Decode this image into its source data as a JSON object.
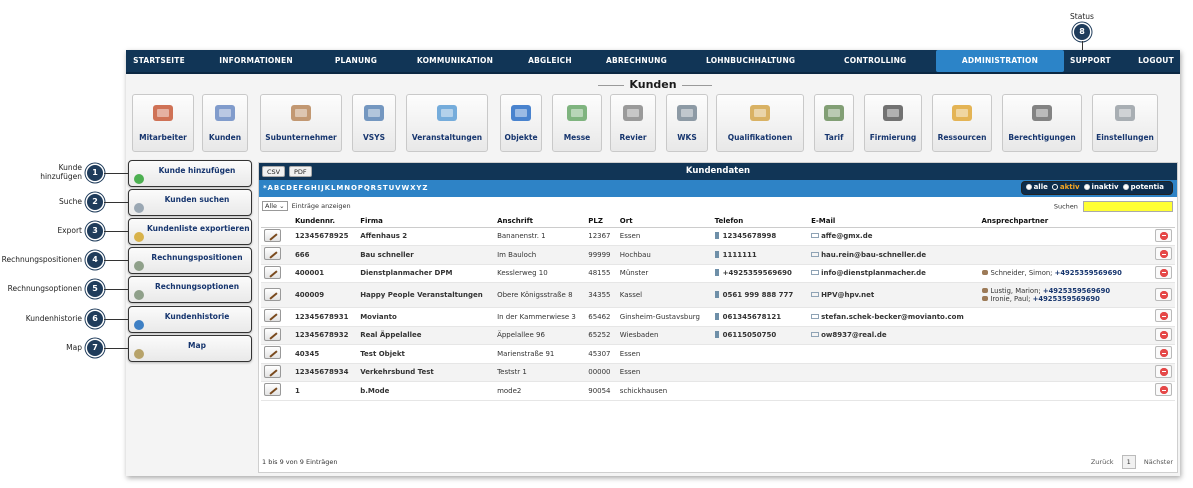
{
  "status_annotation": {
    "label": "Status",
    "number": "8"
  },
  "nav": [
    {
      "label": "STARTSEITE",
      "active": false
    },
    {
      "label": "INFORMATIONEN",
      "active": false
    },
    {
      "label": "PLANUNG",
      "active": false
    },
    {
      "label": "KOMMUNIKATION",
      "active": false
    },
    {
      "label": "ABGLEICH",
      "active": false
    },
    {
      "label": "ABRECHNUNG",
      "active": false
    },
    {
      "label": "LOHNBUCHHALTUNG",
      "active": false
    },
    {
      "label": "CONTROLLING",
      "active": false
    },
    {
      "label": "ADMINISTRATION",
      "active": true
    },
    {
      "label": "SUPPORT",
      "active": false
    },
    {
      "label": "LOGOUT",
      "active": false
    }
  ],
  "section_title": "Kunden",
  "modules": [
    {
      "label": "Mitarbeiter",
      "icon": "people-icon"
    },
    {
      "label": "Kunden",
      "icon": "handshake-icon"
    },
    {
      "label": "Subunternehmer",
      "icon": "partners-icon"
    },
    {
      "label": "VSYS",
      "icon": "network-icon"
    },
    {
      "label": "Veranstaltungen",
      "icon": "event-screen-icon"
    },
    {
      "label": "Objekte",
      "icon": "cube-icon"
    },
    {
      "label": "Messe",
      "icon": "floorplan-icon"
    },
    {
      "label": "Revier",
      "icon": "district-icon"
    },
    {
      "label": "WKS",
      "icon": "document-icon"
    },
    {
      "label": "Qualifikationen",
      "icon": "certificate-icon"
    },
    {
      "label": "Tarif",
      "icon": "tariff-icon"
    },
    {
      "label": "Firmierung",
      "icon": "phone-icon"
    },
    {
      "label": "Ressourcen",
      "icon": "boxes-icon"
    },
    {
      "label": "Berechtigungen",
      "icon": "user-key-icon"
    },
    {
      "label": "Einstellungen",
      "icon": "wrench-icon"
    }
  ],
  "sidebar": [
    {
      "label": "Kunde hinzufügen",
      "icon": "add-icon",
      "icon_color": "#4caf50",
      "annotation": "Kunde hinzufügen",
      "number": "1"
    },
    {
      "label": "Kunden suchen",
      "icon": "search-icon",
      "icon_color": "#9aa7b3",
      "annotation": "Suche",
      "number": "2"
    },
    {
      "label": "Kundenliste exportieren",
      "icon": "export-icon",
      "icon_color": "#d8b24a",
      "annotation": "Export",
      "number": "3"
    },
    {
      "label": "Rechnungspositionen",
      "icon": "invoice-icon",
      "icon_color": "#8fa08a",
      "annotation": "Rechnungspositionen",
      "number": "4"
    },
    {
      "label": "Rechnungsoptionen",
      "icon": "invoice-options-icon",
      "icon_color": "#8fa08a",
      "annotation": "Rechnungsoptionen",
      "number": "5"
    },
    {
      "label": "Kundenhistorie",
      "icon": "info-icon",
      "icon_color": "#3d7fc4",
      "annotation": "Kundenhistorie",
      "number": "6"
    },
    {
      "label": "Map",
      "icon": "map-icon",
      "icon_color": "#b7a36a",
      "annotation": "Map",
      "number": "7"
    }
  ],
  "panel": {
    "title": "Kundendaten",
    "csv": "CSV",
    "pdf": "PDF",
    "alphabet": "*ABCDEFGHIJKLMNOPQRSTUVWXYZ",
    "status_options": [
      {
        "label": "alle",
        "selected": false
      },
      {
        "label": "aktiv",
        "selected": true
      },
      {
        "label": "inaktiv",
        "selected": false
      },
      {
        "label": "potentia",
        "selected": false
      }
    ],
    "page_size": "Alle",
    "entries_label": "Einträge anzeigen",
    "search_label": "Suchen",
    "columns": [
      "",
      "Kundennr.",
      "Firma",
      "Anschrift",
      "PLZ",
      "Ort",
      "Telefon",
      "E-Mail",
      "Ansprechpartner",
      ""
    ],
    "rows": [
      {
        "knr": "12345678925",
        "firma": "Affenhaus 2",
        "anschrift": "Bananenstr. 1",
        "plz": "12367",
        "ort": "Essen",
        "telefon": "12345678998",
        "email": "affe@gmx.de",
        "contacts": []
      },
      {
        "knr": "666",
        "firma": "Bau schneller",
        "anschrift": "Im Bauloch",
        "plz": "99999",
        "ort": "Hochbau",
        "telefon": "1111111",
        "email": "hau.rein@bau-schneller.de",
        "contacts": []
      },
      {
        "knr": "400001",
        "firma": "Dienstplanmacher DPM",
        "anschrift": "Kesslerweg 10",
        "plz": "48155",
        "ort": "Münster",
        "telefon": "+4925359569690",
        "email": "info@dienstplanmacher.de",
        "contacts": [
          {
            "name": "Schneider, Simon;",
            "phone": "+4925359569690"
          }
        ]
      },
      {
        "knr": "400009",
        "firma": "Happy People Veranstaltungen",
        "anschrift": "Obere Königsstraße 8",
        "plz": "34355",
        "ort": "Kassel",
        "telefon": "0561 999 888 777",
        "email": "HPV@hpv.net",
        "contacts": [
          {
            "name": "Lustig, Marion;",
            "phone": "+4925359569690"
          },
          {
            "name": "Ironie, Paul;",
            "phone": "+4925359569690"
          }
        ]
      },
      {
        "knr": "12345678931",
        "firma": "Movianto",
        "anschrift": "In der Kammerwiese 3",
        "plz": "65462",
        "ort": "Ginsheim-Gustavsburg",
        "telefon": "061345678121",
        "email": "stefan.schek-becker@movianto.com",
        "contacts": []
      },
      {
        "knr": "12345678932",
        "firma": "Real Äppelallee",
        "anschrift": "Äppelallee 96",
        "plz": "65252",
        "ort": "Wiesbaden",
        "telefon": "06115050750",
        "email": "ow8937@real.de",
        "contacts": []
      },
      {
        "knr": "40345",
        "firma": "Test Objekt",
        "anschrift": "Marienstraße 91",
        "plz": "45307",
        "ort": "Essen",
        "telefon": "",
        "email": "",
        "contacts": []
      },
      {
        "knr": "12345678934",
        "firma": "Verkehrsbund Test",
        "anschrift": "Teststr 1",
        "plz": "00000",
        "ort": "Essen",
        "telefon": "",
        "email": "",
        "contacts": []
      },
      {
        "knr": "1",
        "firma": "b.Mode",
        "anschrift": "mode2",
        "plz": "90054",
        "ort": "schickhausen",
        "telefon": "",
        "email": "",
        "contacts": []
      }
    ],
    "footer_info": "1 bis 9 von 9 Einträgen",
    "pager": {
      "prev": "Zurück",
      "current": "1",
      "next": "Nächster"
    }
  },
  "colors": {
    "nav_bg": "#113556",
    "active_tab": "#2c84c8",
    "alpha_bar": "#2e83c6",
    "search_box": "#ffff33",
    "link_text": "#16356e"
  }
}
